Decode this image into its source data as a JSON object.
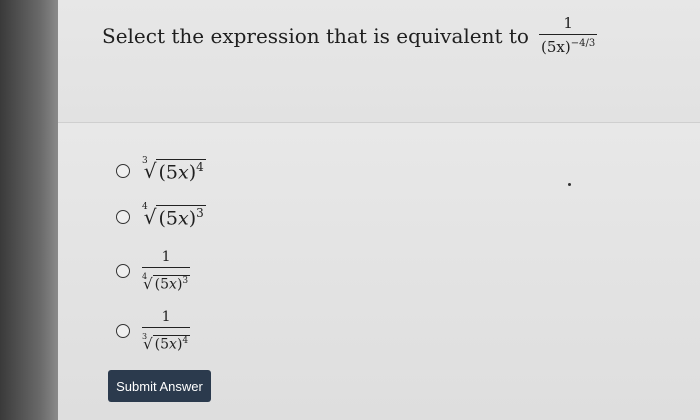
{
  "question": {
    "prompt": "Select the expression that is equivalent to",
    "fraction": {
      "numerator": "1",
      "base": "(5x)",
      "exponent": "−4/3"
    }
  },
  "options": [
    {
      "label": "∛((5x)^4)",
      "selected": false
    },
    {
      "label": "∜((5x)^3)",
      "selected": false
    },
    {
      "label": "1 / ∜((5x)^3)",
      "selected": false
    },
    {
      "label": "1 / ∛((5x)^4)",
      "selected": false
    }
  ],
  "submit_label": "Submit Answer"
}
